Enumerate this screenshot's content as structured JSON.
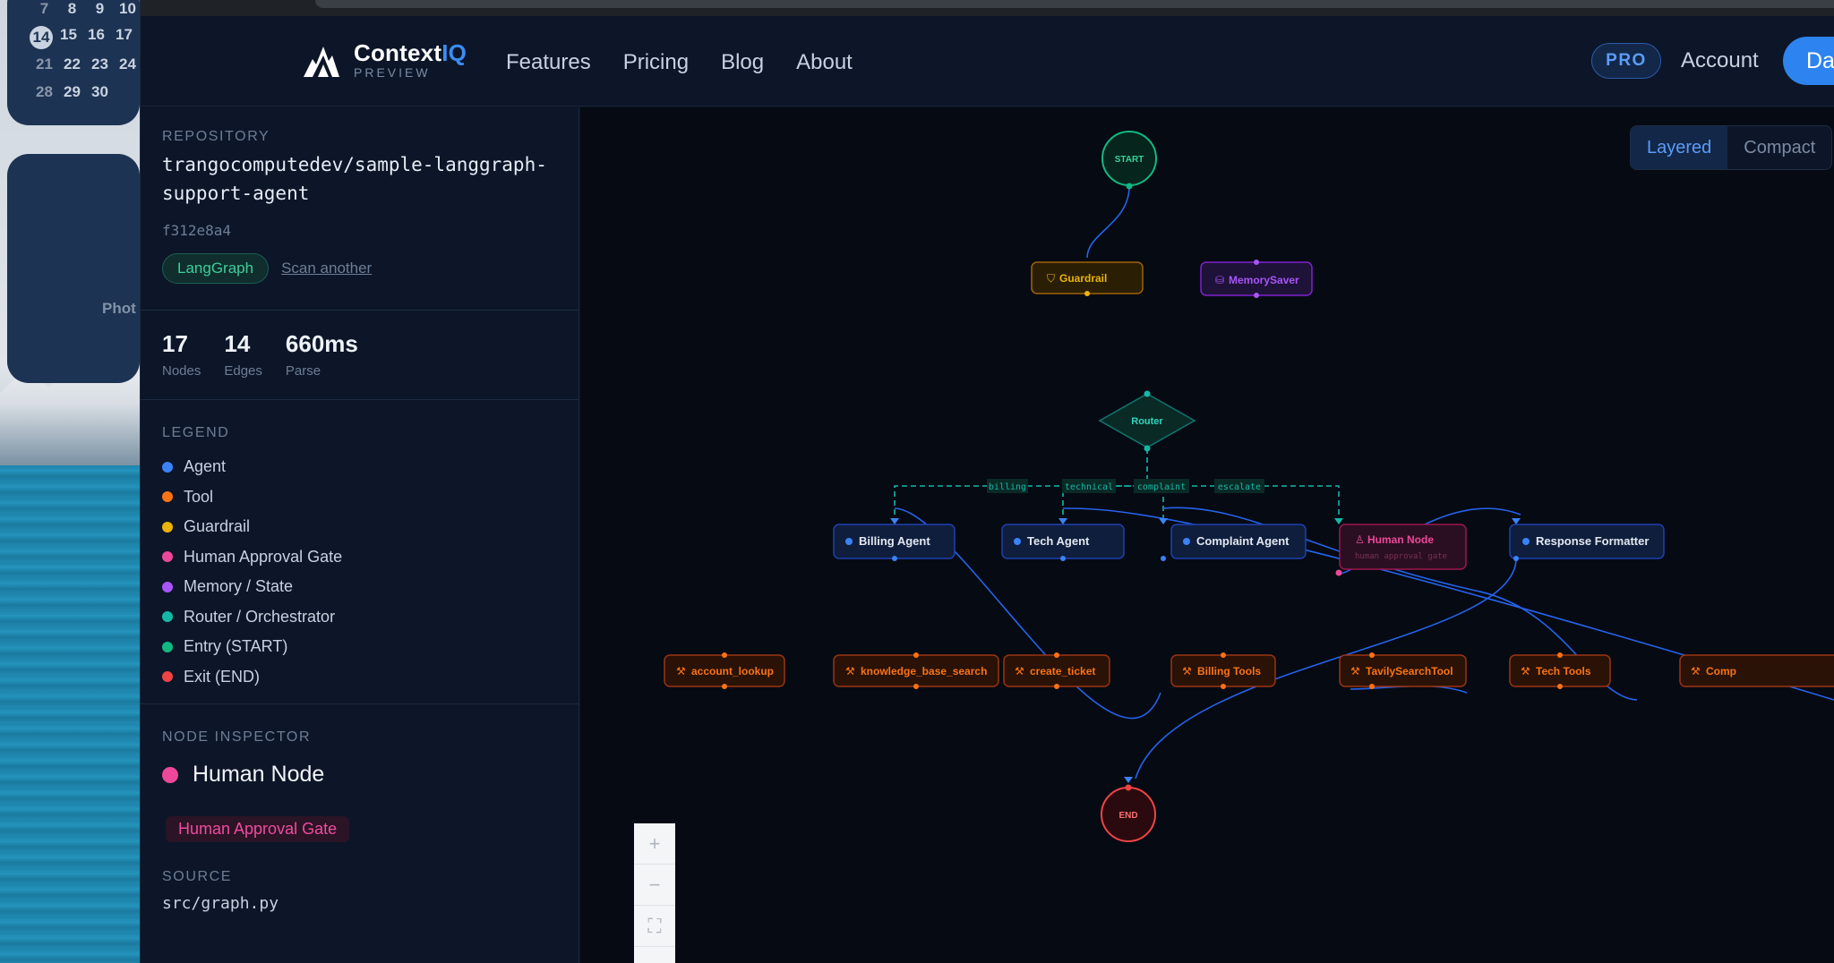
{
  "desktop": {
    "calendar": {
      "rows": [
        [
          "7",
          "8",
          "9",
          "10"
        ],
        [
          "14",
          "15",
          "16",
          "17"
        ],
        [
          "21",
          "22",
          "23",
          "24"
        ],
        [
          "28",
          "29",
          "30"
        ]
      ]
    },
    "photos_label": "Phot"
  },
  "header": {
    "brand": "Context",
    "brand_accent": "IQ",
    "brand_sub": "PREVIEW",
    "nav": [
      "Features",
      "Pricing",
      "Blog",
      "About"
    ],
    "pro_label": "PRO",
    "account_label": "Account",
    "dashboard_label": "Da"
  },
  "sidebar": {
    "repository_label": "REPOSITORY",
    "repo_name": "trangocomputedev/sample-langgraph-support-agent",
    "commit": "f312e8a4",
    "framework_tag": "LangGraph",
    "scan_link": "Scan another",
    "stats": [
      {
        "value": "17",
        "label": "Nodes"
      },
      {
        "value": "14",
        "label": "Edges"
      },
      {
        "value": "660ms",
        "label": "Parse"
      }
    ],
    "legend_label": "LEGEND",
    "legend": [
      {
        "label": "Agent",
        "color": "#3b82f6"
      },
      {
        "label": "Tool",
        "color": "#f97316"
      },
      {
        "label": "Guardrail",
        "color": "#eab308"
      },
      {
        "label": "Human Approval Gate",
        "color": "#ec4899"
      },
      {
        "label": "Memory / State",
        "color": "#a855f7"
      },
      {
        "label": "Router / Orchestrator",
        "color": "#14b8a6"
      },
      {
        "label": "Entry (START)",
        "color": "#10b981"
      },
      {
        "label": "Exit (END)",
        "color": "#ef4444"
      }
    ],
    "inspector_label": "NODE INSPECTOR",
    "inspector_node": "Human Node",
    "inspector_color": "#ec4899",
    "inspector_type": "Human Approval Gate",
    "source_label": "SOURCE",
    "source_path": "src/graph.py"
  },
  "canvas": {
    "view_modes": [
      "Layered",
      "Compact"
    ],
    "active_mode": "Layered",
    "nodes": {
      "start": "START",
      "end": "END",
      "guardrail": "Guardrail",
      "memory": "MemorySaver",
      "router": "Router",
      "billing_agent": "Billing Agent",
      "tech_agent": "Tech Agent",
      "complaint_agent": "Complaint Agent",
      "human_node": "Human Node",
      "human_sub": "human approval gate",
      "response_formatter": "Response Formatter",
      "account_lookup": "account_lookup",
      "kb_search": "knowledge_base_search",
      "create_ticket": "create_ticket",
      "billing_tools": "Billing Tools",
      "tavily": "TavilySearchTool",
      "tech_tools": "Tech Tools",
      "comp_tools": "Comp"
    },
    "edge_labels": [
      "billing",
      "technical",
      "complaint",
      "escalate"
    ],
    "zoom_controls": [
      "+",
      "−",
      "⛶"
    ]
  }
}
